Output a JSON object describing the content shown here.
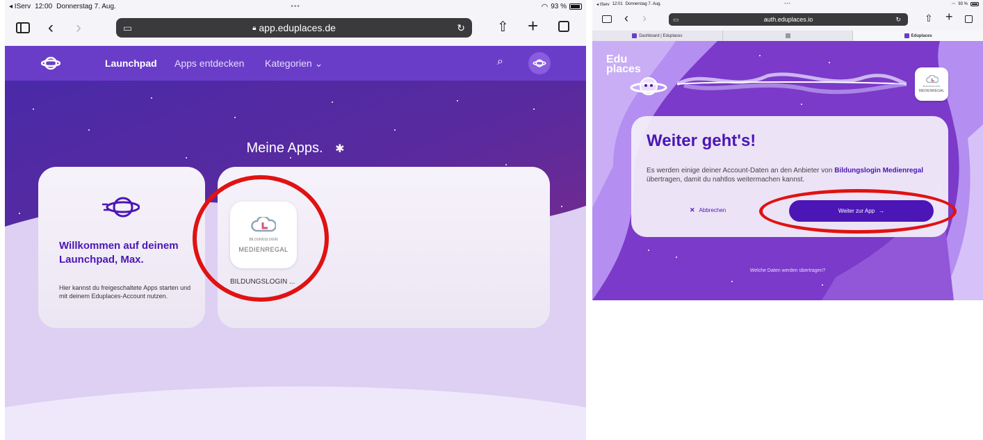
{
  "left": {
    "status": {
      "back_app": "◂ IServ",
      "time": "12:00",
      "date": "Donnerstag 7. Aug.",
      "battery": "93 %"
    },
    "url": "app.eduplaces.de",
    "nav": {
      "launchpad": "Launchpad",
      "apps": "Apps entdecken",
      "categories": "Kategorien"
    },
    "section_title": "Meine Apps",
    "welcome_title": "Willkommen auf deinem Launchpad, Max.",
    "welcome_text": "Hier kannst du freigeschaltete Apps starten und mit deinem Eduplaces-Account nutzen.",
    "app_tile": {
      "logo_top": "BILDUNGSLOGIN",
      "logo_bottom": "MEDIENREGAL",
      "label": "BILDUNGSLOGIN ..."
    }
  },
  "right": {
    "status": {
      "back_app": "◂ IServ",
      "time": "12:01",
      "date": "Donnerstag 7. Aug.",
      "battery": "93 %"
    },
    "url": "auth.eduplaces.io",
    "tabs": [
      "Dashboard | Eduplaces",
      "",
      "Eduplaces"
    ],
    "brand": "Edu places",
    "partner_logo_top": "BILDUNGSLOGIN",
    "partner_logo_bottom": "MEDIENREGAL",
    "heading": "Weiter geht's!",
    "text_before": "Es werden einige deiner Account-Daten an den Anbieter von ",
    "text_bold": "Bildungslogin Medienregal",
    "text_after": " übertragen, damit du nahtlos weitermachen kannst.",
    "cancel": "Abbrechen",
    "continue": "Weiter zur App",
    "data_link": "Welche Daten werden übertragen?"
  },
  "colors": {
    "purple": "#6a3dc9",
    "deep_purple": "#4b16b5",
    "annotation_red": "#e01212"
  }
}
